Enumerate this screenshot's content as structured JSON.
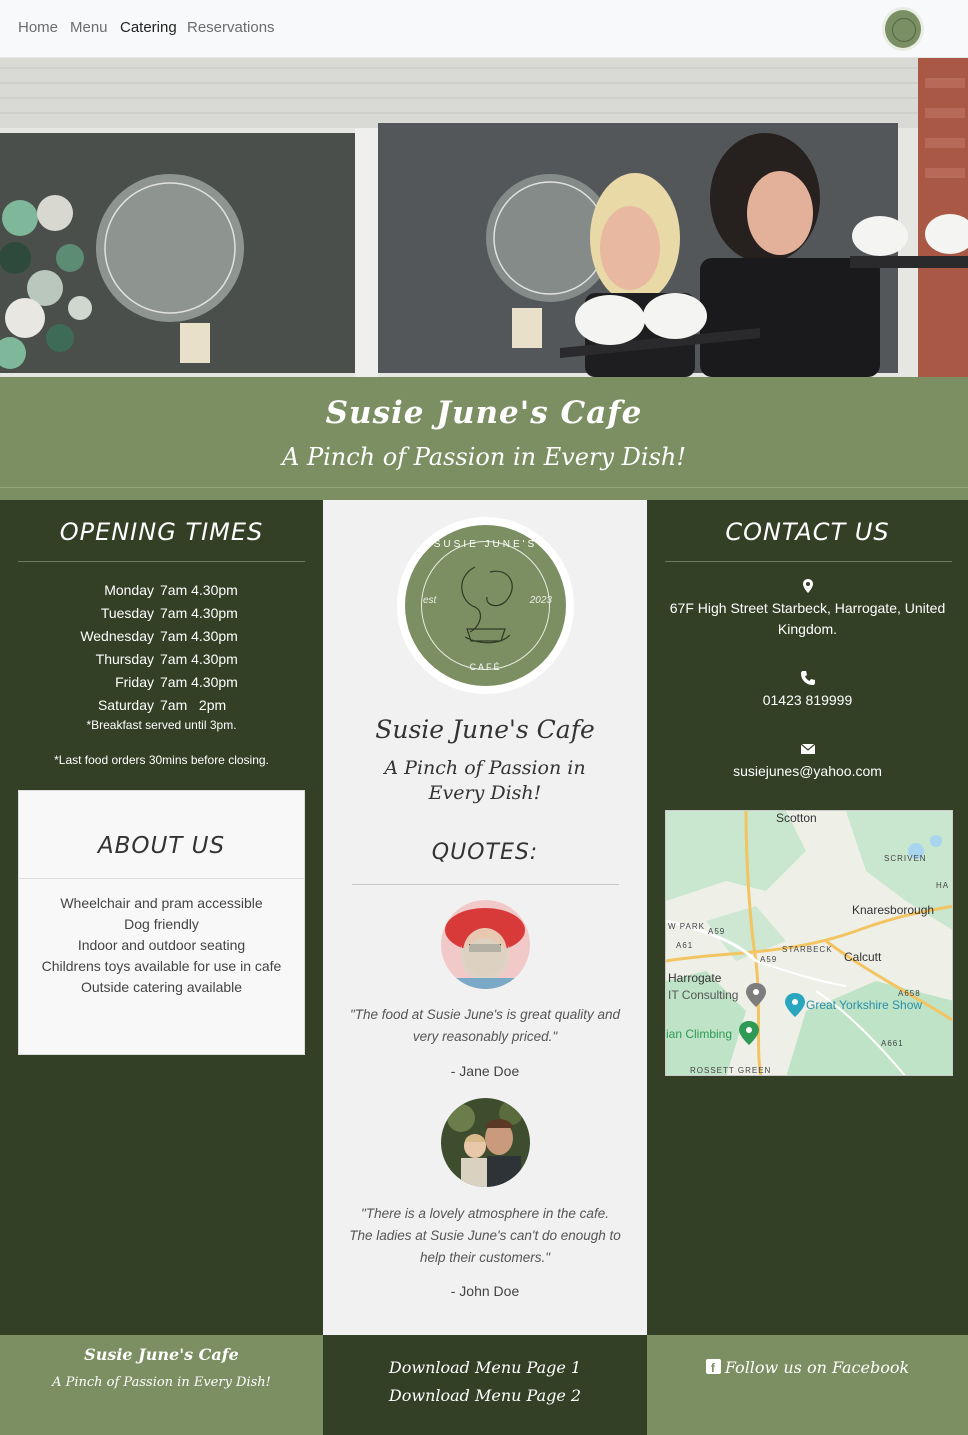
{
  "nav": {
    "items": [
      {
        "label": "Home"
      },
      {
        "label": "Menu"
      },
      {
        "label": "Catering"
      },
      {
        "label": "Reservations"
      }
    ]
  },
  "banner": {
    "title": "Susie June's Cafe",
    "tagline": "A Pinch of Passion in Every Dish!"
  },
  "opening": {
    "heading": "OPENING TIMES",
    "hours": [
      {
        "day": "Monday",
        "time": "7am 4.30pm"
      },
      {
        "day": "Tuesday",
        "time": "7am 4.30pm"
      },
      {
        "day": "Wednesday",
        "time": "7am 4.30pm"
      },
      {
        "day": "Thursday",
        "time": "7am 4.30pm"
      },
      {
        "day": "Friday",
        "time": "7am 4.30pm"
      },
      {
        "day": "Saturday",
        "time": "7am   2pm"
      }
    ],
    "note1": "*Breakfast served until 3pm.",
    "note2": "*Last food orders 30mins before closing."
  },
  "about": {
    "heading": "ABOUT US",
    "items": [
      "Wheelchair and pram accessible",
      "Dog friendly",
      "Indoor and outdoor seating",
      "Childrens toys available for use in cafe",
      "Outside catering available"
    ]
  },
  "middle": {
    "logo_top": "SUSIE JUNE'S",
    "logo_bottom": "CAFÉ",
    "logo_est": "est",
    "logo_year": "2023",
    "title": "Susie June's Cafe",
    "tagline": "A Pinch of Passion in Every Dish!",
    "quotes_heading": "QUOTES:",
    "quotes": [
      {
        "text": "\"The food at Susie June's is great quality and very reasonably priced.\"",
        "author": "- Jane Doe"
      },
      {
        "text": "\"There is a lovely atmosphere in the cafe. The ladies at Susie June's can't do enough to help their customers.\"",
        "author": "- John Doe"
      }
    ]
  },
  "contact": {
    "heading": "CONTACT US",
    "address": "67F High Street Starbeck, Harrogate, United Kingdom.",
    "phone": "01423 819999",
    "email": "susiejunes@yahoo.com",
    "map_labels": {
      "scotton": "Scotton",
      "scriven": "SCRIVEN",
      "ha": "HA",
      "knaresborough": "Knaresborough",
      "wpark": "W PARK",
      "starbeck": "STARBECK",
      "calcutt": "Calcutt",
      "harrogate": "Harrogate",
      "it": "IT Consulting",
      "gys": "Great Yorkshire Show",
      "climbing": "ian Climbing",
      "rossett": "ROSSETT GREEN",
      "a59a": "A59",
      "a59b": "A59",
      "a61": "A61",
      "a658": "A658",
      "a661": "A661"
    }
  },
  "footer": {
    "title": "Susie June's Cafe",
    "tagline": "A Pinch of Passion in Every Dish!",
    "download1": "Download Menu Page 1",
    "download2": "Download Menu Page 2",
    "facebook": "Follow us on Facebook"
  },
  "colors": {
    "sage": "#7b8f62",
    "dark_green": "#334026",
    "light_bg": "#f1f1f1"
  }
}
